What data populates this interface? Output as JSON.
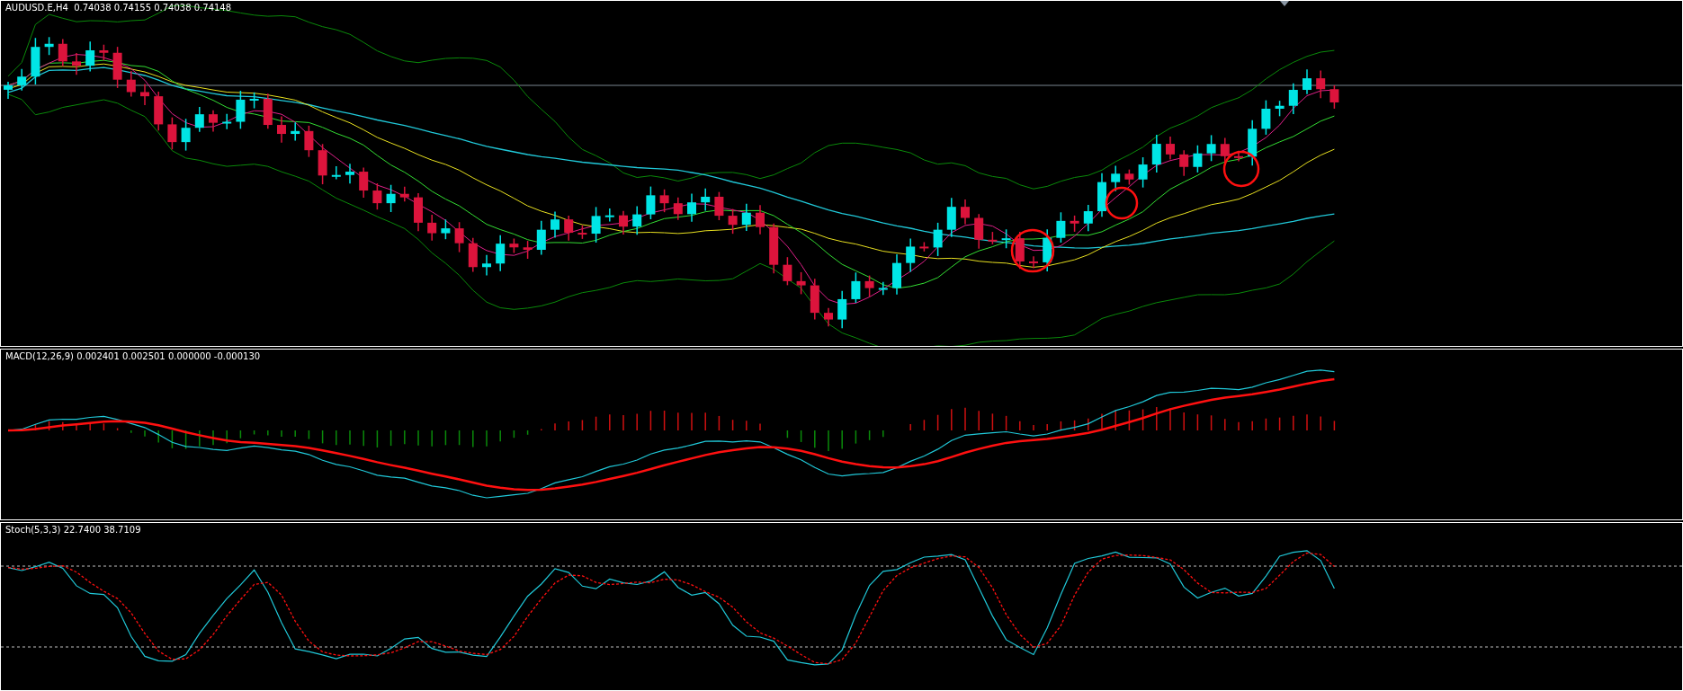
{
  "panels": [
    {
      "kind": "price",
      "title": "AUDUSD.E,H4  0.74038 0.74155 0.74038 0.74148"
    },
    {
      "kind": "macd",
      "title": "MACD(12,26,9) 0.002401 0.002501 0.000000 -0.000130"
    },
    {
      "kind": "stoch",
      "title": "Stoch(5,3,3) 22.7400 38.7109"
    }
  ]
}
